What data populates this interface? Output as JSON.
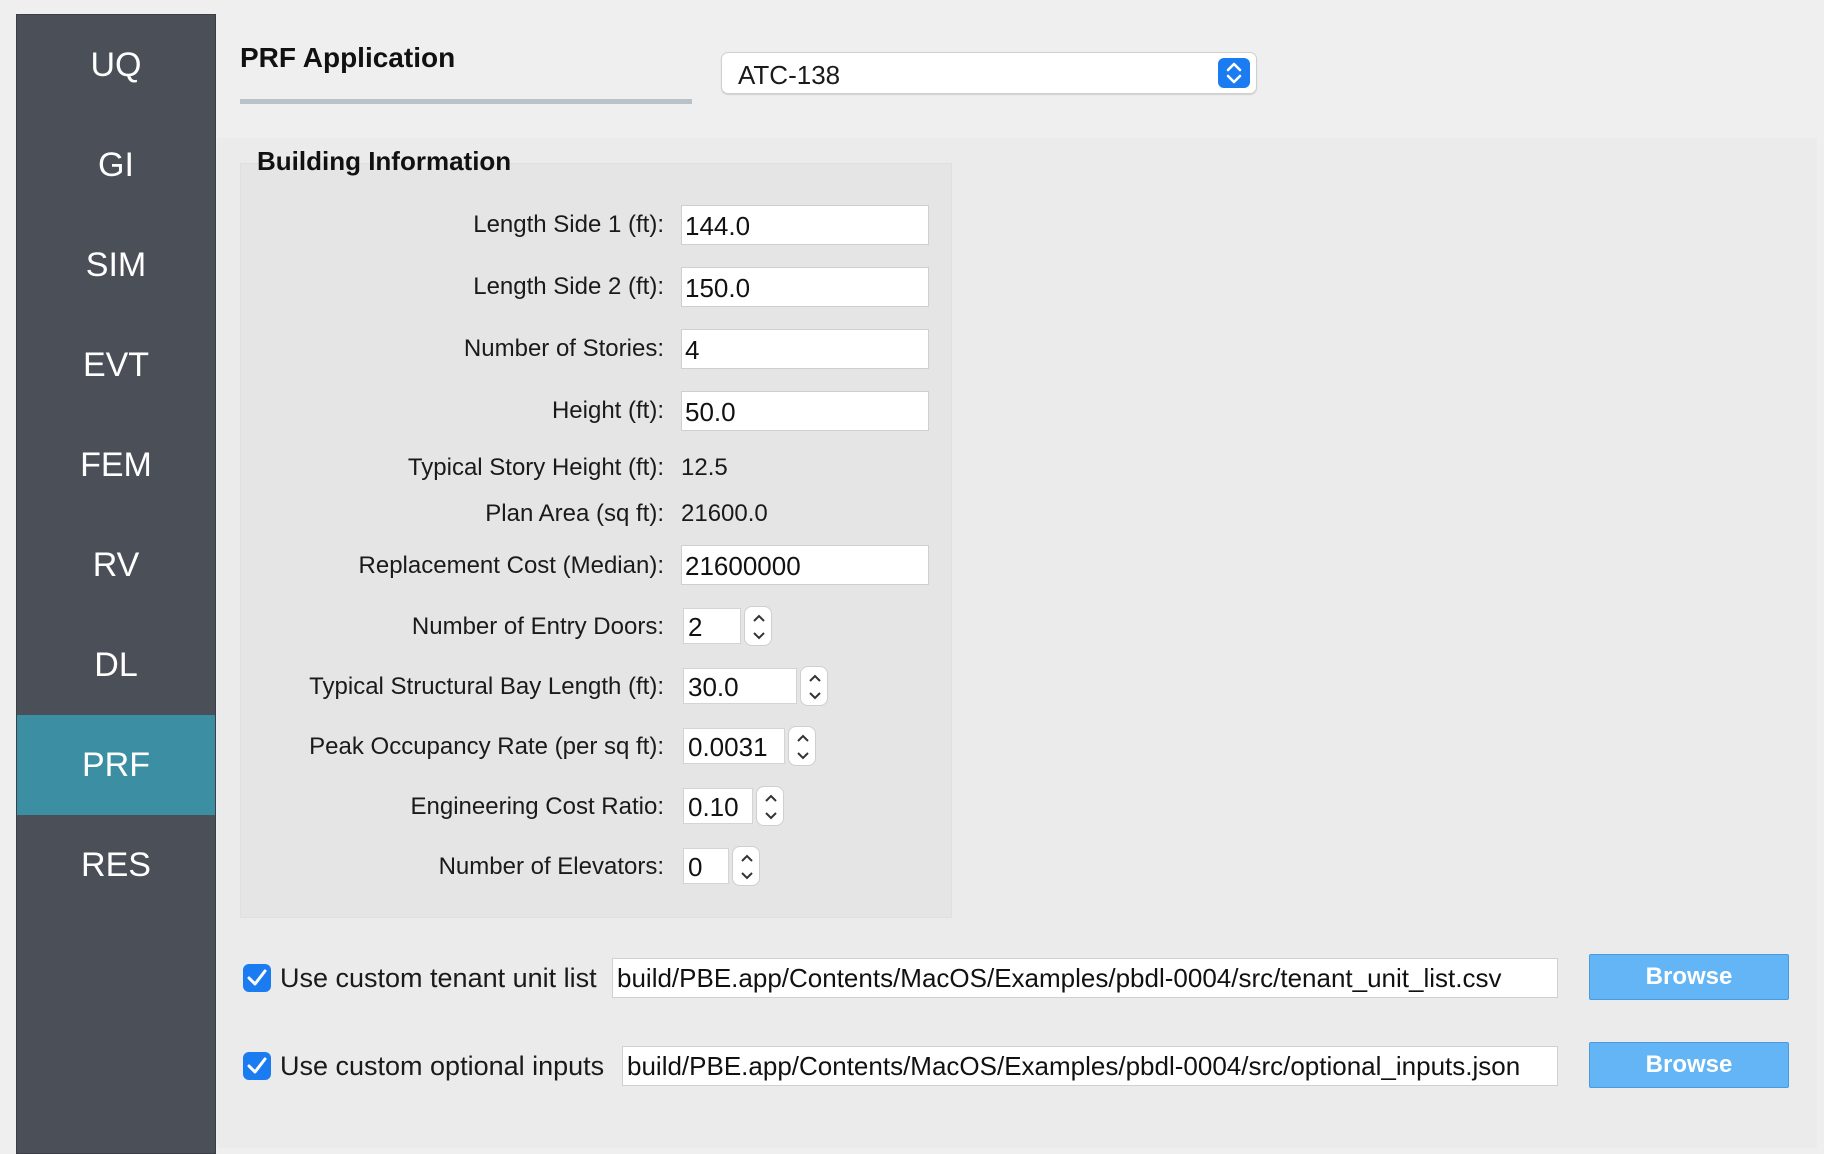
{
  "sidebar": {
    "items": [
      {
        "label": "UQ",
        "active": false
      },
      {
        "label": "GI",
        "active": false
      },
      {
        "label": "SIM",
        "active": false
      },
      {
        "label": "EVT",
        "active": false
      },
      {
        "label": "FEM",
        "active": false
      },
      {
        "label": "RV",
        "active": false
      },
      {
        "label": "DL",
        "active": false
      },
      {
        "label": "PRF",
        "active": true
      },
      {
        "label": "RES",
        "active": false
      }
    ]
  },
  "header": {
    "title": "PRF Application",
    "application_select": {
      "selected": "ATC-138"
    }
  },
  "building_info": {
    "title": "Building Information",
    "fields": {
      "length_side_1": {
        "label": "Length Side 1 (ft):",
        "value": "144.0"
      },
      "length_side_2": {
        "label": "Length Side 2 (ft):",
        "value": "150.0"
      },
      "num_stories": {
        "label": "Number of Stories:",
        "value": "4"
      },
      "height": {
        "label": "Height (ft):",
        "value": "50.0"
      },
      "typical_story_height": {
        "label": "Typical Story Height (ft):",
        "value": "12.5"
      },
      "plan_area": {
        "label": "Plan Area (sq ft):",
        "value": "21600.0"
      },
      "replacement_cost": {
        "label": "Replacement Cost (Median):",
        "value": "21600000"
      },
      "entry_doors": {
        "label": "Number of Entry Doors:",
        "value": "2"
      },
      "bay_length": {
        "label": "Typical Structural Bay Length (ft):",
        "value": "30.0"
      },
      "occupancy_rate": {
        "label": "Peak Occupancy Rate (per sq ft):",
        "value": "0.0031"
      },
      "engineering_cost_ratio": {
        "label": "Engineering Cost Ratio:",
        "value": "0.10"
      },
      "num_elevators": {
        "label": "Number of Elevators:",
        "value": "0"
      }
    }
  },
  "custom_inputs": {
    "tenant_unit_list": {
      "checked": true,
      "label": "Use custom tenant unit list",
      "path": "build/PBE.app/Contents/MacOS/Examples/pbdl-0004/src/tenant_unit_list.csv",
      "browse_label": "Browse"
    },
    "optional_inputs": {
      "checked": true,
      "label": "Use custom optional inputs",
      "path": "build/PBE.app/Contents/MacOS/Examples/pbdl-0004/src/optional_inputs.json",
      "browse_label": "Browse"
    }
  },
  "colors": {
    "sidebar_bg": "#4b5058",
    "sidebar_active": "#3c8fa3",
    "accent_blue": "#1a7cf0",
    "browse_button": "#64b5f6"
  }
}
